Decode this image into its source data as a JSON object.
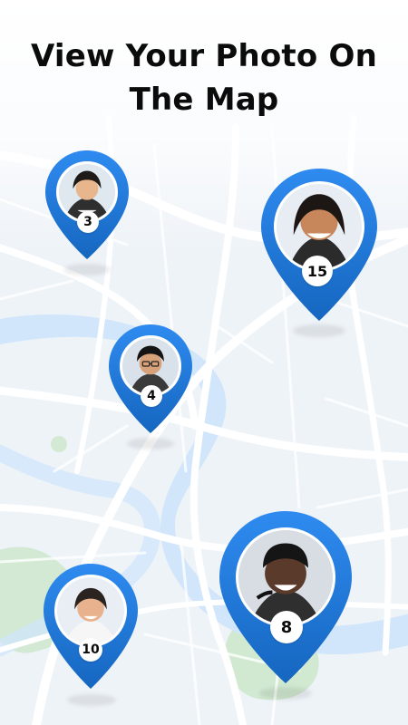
{
  "header": {
    "title": "View Your Photo On The Map"
  },
  "pins": [
    {
      "label": "3",
      "colors": {
        "pin": "#1876d2",
        "pinLight": "#2f8bf0"
      },
      "avatar": "person-portrait-avatar"
    },
    {
      "label": "15",
      "colors": {
        "pin": "#1876d2",
        "pinLight": "#2f8bf0"
      },
      "avatar": "person-portrait-avatar"
    },
    {
      "label": "4",
      "colors": {
        "pin": "#1876d2",
        "pinLight": "#2f8bf0"
      },
      "avatar": "person-portrait-avatar"
    },
    {
      "label": "10",
      "colors": {
        "pin": "#1876d2",
        "pinLight": "#2f8bf0"
      },
      "avatar": "person-portrait-avatar"
    },
    {
      "label": "8",
      "colors": {
        "pin": "#1876d2",
        "pinLight": "#2f8bf0"
      },
      "avatar": "person-portrait-avatar"
    }
  ],
  "map": {
    "colors": {
      "land": "#eef3f8",
      "roads": "#ffffff",
      "water": "#cfe5fb",
      "park": "#cfe8cf"
    }
  }
}
